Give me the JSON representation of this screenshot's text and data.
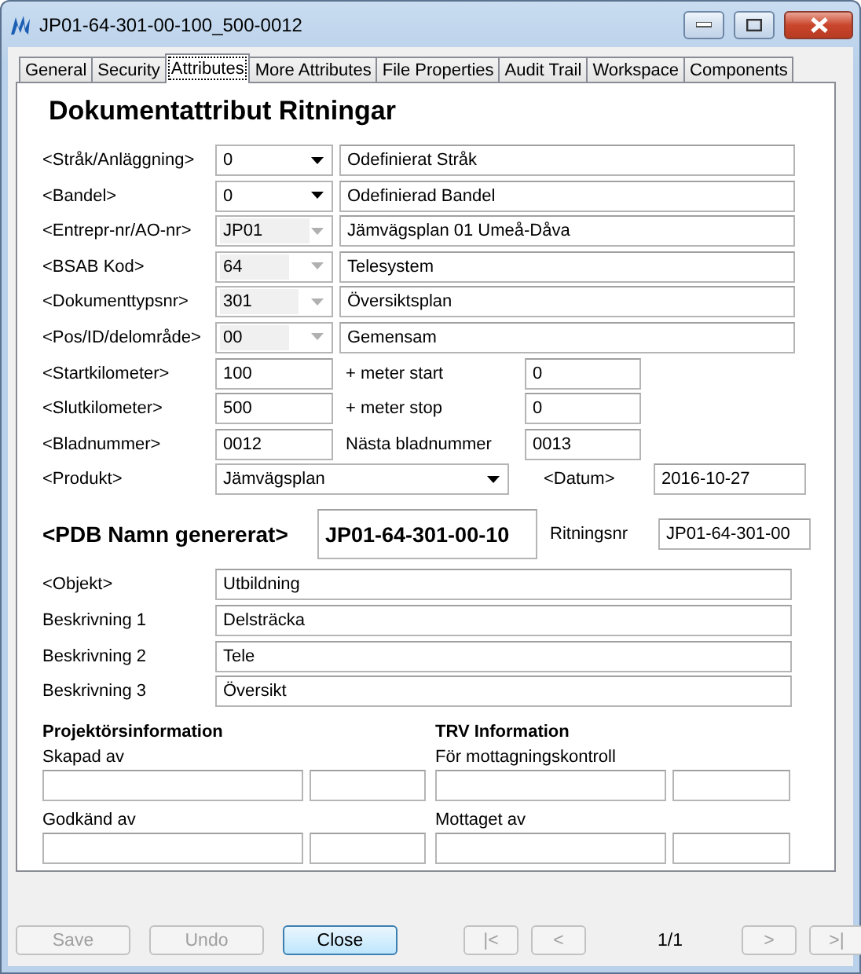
{
  "window": {
    "title": "JP01-64-301-00-100_500-0012"
  },
  "tabs": [
    {
      "label": "General",
      "selected": false
    },
    {
      "label": "Security",
      "selected": false
    },
    {
      "label": "Attributes",
      "selected": true
    },
    {
      "label": "More Attributes",
      "selected": false
    },
    {
      "label": "File Properties",
      "selected": false
    },
    {
      "label": "Audit Trail",
      "selected": false
    },
    {
      "label": "Workspace",
      "selected": false
    },
    {
      "label": "Components",
      "selected": false
    }
  ],
  "heading": "Dokumentattribut Ritningar",
  "code_rows": [
    {
      "label": "<Stråk/Anläggning>",
      "code": "0",
      "disabled": false,
      "description": "Odefinierat Stråk"
    },
    {
      "label": "<Bandel>",
      "code": "0",
      "disabled": false,
      "description": "Odefinierad Bandel"
    },
    {
      "label": "<Entrepr-nr/AO-nr>",
      "code": "JP01",
      "disabled": true,
      "description": "Jämvägsplan 01 Umeå-Dåva"
    },
    {
      "label": "<BSAB Kod>",
      "code": "64",
      "disabled": true,
      "description": "Telesystem"
    },
    {
      "label": "<Dokumenttypsnr>",
      "code": "301",
      "disabled": true,
      "description": "Översiktsplan"
    },
    {
      "label": "<Pos/ID/delområde>",
      "code": "00",
      "disabled": true,
      "description": "Gemensam"
    }
  ],
  "km_rows": [
    {
      "label": "<Startkilometer>",
      "value": "100",
      "extra_label": "+ meter start",
      "extra_value": "0"
    },
    {
      "label": "<Slutkilometer>",
      "value": "500",
      "extra_label": "+ meter stop",
      "extra_value": "0"
    },
    {
      "label": "<Bladnummer>",
      "value": "0012",
      "extra_label": "Nästa bladnummer",
      "extra_value": "0013"
    }
  ],
  "product": {
    "label": "<Produkt>",
    "value": "Jämvägsplan",
    "date_label": "<Datum>",
    "date": "2016-10-27"
  },
  "pdb": {
    "label": "<PDB Namn genererat>",
    "value": "JP01-64-301-00-10",
    "drawing_label": "Ritningsnr",
    "drawing_value": "JP01-64-301-00"
  },
  "text_rows": [
    {
      "label": "<Objekt>",
      "value": "Utbildning"
    },
    {
      "label": "Beskrivning 1",
      "value": "Delsträcka"
    },
    {
      "label": "Beskrivning 2",
      "value": "Tele"
    },
    {
      "label": "Beskrivning 3",
      "value": "Översikt"
    }
  ],
  "signoff": [
    {
      "title": "Projektörsinformation",
      "fields": [
        "Skapad av",
        "Godkänd av"
      ]
    },
    {
      "title": "TRV Information",
      "fields": [
        "För mottagningskontroll",
        "Mottaget av"
      ]
    }
  ],
  "buttons": [
    {
      "label": "Save",
      "disabled": true
    },
    {
      "label": "Undo",
      "disabled": true
    },
    {
      "label": "Close",
      "disabled": false
    }
  ],
  "nav_back": [
    {
      "label": "|<",
      "disabled": true
    },
    {
      "label": "<",
      "disabled": true
    }
  ],
  "page": "1/1",
  "nav_forward": [
    {
      "label": ">",
      "disabled": true
    },
    {
      "label": ">|",
      "disabled": true
    }
  ]
}
